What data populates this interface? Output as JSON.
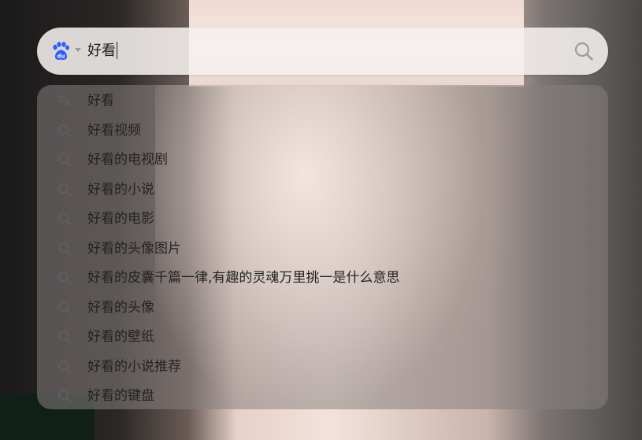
{
  "search": {
    "engine_icon": "baidu-paw-icon",
    "query": "好看",
    "search_icon": "magnifier-icon"
  },
  "suggestions": [
    {
      "icon": "translate-icon",
      "text": "好看"
    },
    {
      "icon": "search-icon",
      "text": "好看视频"
    },
    {
      "icon": "search-icon",
      "text": "好看的电视剧"
    },
    {
      "icon": "search-icon",
      "text": "好看的小说"
    },
    {
      "icon": "search-icon",
      "text": "好看的电影"
    },
    {
      "icon": "search-icon",
      "text": "好看的头像图片"
    },
    {
      "icon": "search-icon",
      "text": "好看的皮囊千篇一律,有趣的灵魂万里挑一是什么意思"
    },
    {
      "icon": "search-icon",
      "text": "好看的头像"
    },
    {
      "icon": "search-icon",
      "text": "好看的壁纸"
    },
    {
      "icon": "search-icon",
      "text": "好看的小说推荐"
    },
    {
      "icon": "search-icon",
      "text": "好看的键盘"
    }
  ],
  "colors": {
    "baidu_blue": "#2b5cff",
    "icon_gray": "#5f5f5f"
  }
}
